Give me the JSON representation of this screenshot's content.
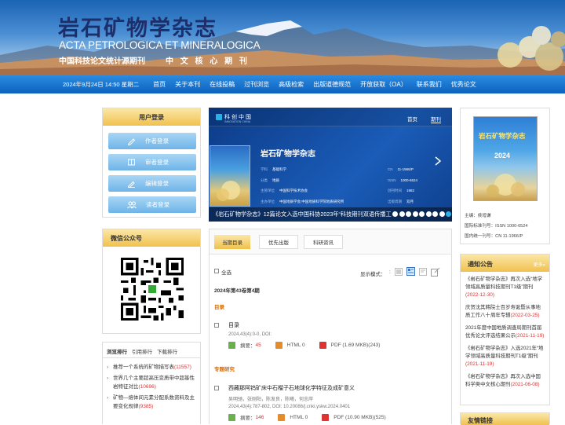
{
  "header": {
    "title_cn": "岩石矿物学杂志",
    "title_en": "ACTA PETROLOGICA ET MINERALOGICA",
    "sub_left": "中国科技论文统计源期刊",
    "sub_right": "中 文 核 心 期 刊"
  },
  "nav": {
    "date": "2024年9月24日 14:50 星期二",
    "items": [
      "首页",
      "关于本刊",
      "在线投稿",
      "过刊浏览",
      "高级检索",
      "出版道德规范",
      "开放获取（OA）",
      "联系我们",
      "优秀论文"
    ]
  },
  "login": {
    "title": "用户登录",
    "buttons": [
      "作者登录",
      "审者登录",
      "编辑登录",
      "读者登录"
    ]
  },
  "wechat": {
    "title": "微信公众号"
  },
  "rank": {
    "tabs": [
      "浏览排行",
      "引用排行",
      "下载排行"
    ],
    "items": [
      {
        "text": "推荐一个系统的矿物描写表",
        "count": "(11557)"
      },
      {
        "text": "世界几个主要超高压变质带中超基性岩特征对比",
        "count": "(10696)"
      },
      {
        "text": "矿物—熔体间元素分配系数资料及主要变化规律",
        "count": "(9385)"
      }
    ]
  },
  "slider": {
    "brand": "科创中国",
    "brand_en": "INNOVATION CHINA",
    "tab_home": "首页",
    "tab_issue": "期刊",
    "journal": "岩石矿物学杂志",
    "info_left": [
      {
        "k": "学科",
        "v": "基础科学"
      },
      {
        "k": "分类",
        "v": "地质"
      },
      {
        "k": "主管单位",
        "v": "中国科学技术协会"
      },
      {
        "k": "主办单位",
        "v": "中国地质学会;中国地质科学院地质研究所"
      }
    ],
    "info_right": [
      {
        "k": "CN",
        "v": "11-1966/P"
      },
      {
        "k": "ISSN",
        "v": "1000-6524"
      },
      {
        "k": "创刊时间",
        "v": "1982"
      },
      {
        "k": "出版周期",
        "v": "双月"
      }
    ],
    "caption": "《岩石矿物学杂志》12篇论文入选中国科协2023年“科技期刊双语传播工程”",
    "dots": 9,
    "active_dot": 8
  },
  "issue_tabs": [
    "当期目录",
    "优先出版",
    "科研资讯"
  ],
  "toolbar": {
    "select_all": "全选",
    "display_mode": "显示模式：",
    "mode_colon": ":"
  },
  "volume": "2024年第43卷第4期",
  "sections": [
    {
      "title": "目录",
      "articles": [
        {
          "title": "目录",
          "authors": "",
          "cite": "2024,43(4):0-0, DOI:",
          "abstract": "摘要：",
          "abs_count": "45",
          "html": "HTML 0",
          "pdf": "PDF (1.69 MKB)(243)"
        }
      ]
    },
    {
      "title": "专题研究",
      "articles": [
        {
          "title": "西藏那阿钨矿床中石榴子石地球化学特征及成矿意义",
          "authors": "吴明驰，张刚阳，陈发良，陈曦，何忠岸",
          "cite": "2024,43(4):787-802, DOI: 10.20086/j.cnki.yskw.2024.0401",
          "abstract": "摘要：",
          "abs_count": "146",
          "html": "HTML 0",
          "pdf": "PDF (10.90 MKB)(525)"
        }
      ]
    }
  ],
  "cover": {
    "editor": "主编：侯增谦",
    "issn": "国际标准刊号：ISSN 1000-6524",
    "cn": "国内统一刊号：CN 11-1966/P",
    "cover_title": "岩石矿物学杂志",
    "cover_year": "2024"
  },
  "notices": {
    "title": "通知公告",
    "more": "更多»",
    "items": [
      {
        "text": "《岩石矿物学杂志》再次入选“地学领域高质量科技期刊T1级”期刊",
        "date": "(2022-12-30)"
      },
      {
        "text": "庆贺沈其韩院士百岁寿诞暨从事地质工作八十周年专辑",
        "date": "(2022-03-25)"
      },
      {
        "text": "2021年度中国地质调查局期刊首届优秀论文评选结果公示",
        "date": "(2021-11-19)"
      },
      {
        "text": "《岩石矿物学杂志》入选2021年“地学领域高质量科技期刊T1级”期刊",
        "date": "(2021-11-19)"
      },
      {
        "text": "《岩石矿物学杂志》再次入选中国科学类中文核心期刊",
        "date": "(2021-06-08)"
      }
    ]
  },
  "links": {
    "title": "友情链接"
  },
  "colors": {
    "nav": "#0c62bf",
    "accent": "#f0c14e",
    "link_red": "#d33",
    "slider_bg": "#0f3f8c"
  }
}
